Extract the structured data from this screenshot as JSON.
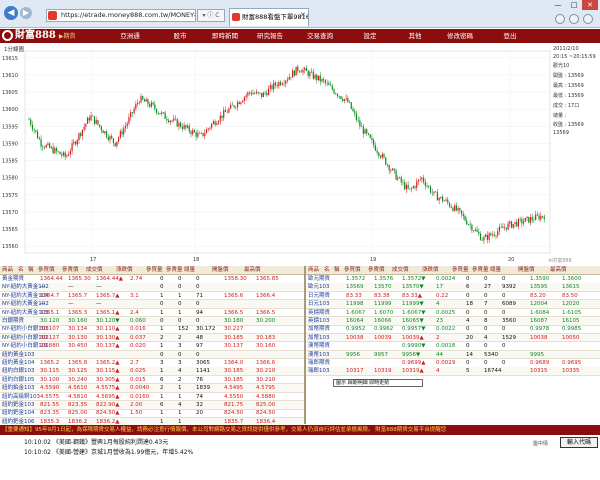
{
  "browser": {
    "address": "https://etrade.money888.com.tw/MONEY888/",
    "tab_title": "財富888看盤下單9816260",
    "tools": "▾ ⓘ C",
    "back": "◀",
    "fwd": "▶",
    "close": "✕",
    "win_min": "—",
    "win_max": "□",
    "win_close": "✕"
  },
  "site": {
    "logo": "財富888",
    "logo_sub": "▶期貨",
    "nav": [
      "亞洲通",
      "股市",
      "即時新聞",
      "研究報告",
      "交易查詢",
      "設定",
      "其他",
      "修改密碼",
      "登出"
    ]
  },
  "chart_panel": {
    "title": "1分線圖",
    "y_ticks": [
      "13615",
      "13610",
      "13605",
      "13600",
      "13595",
      "13590",
      "13585",
      "13580",
      "13575",
      "13570",
      "13565",
      "13560"
    ],
    "x_ticks": [
      "17",
      "18",
      "19",
      "20"
    ],
    "side": {
      "date": "2011/2/10",
      "time": "20:15 ~20:15:59",
      "label_title": "歡光10",
      "open": "開盤 : 13569",
      "high": "最高 : 13569",
      "low": "最低 : 13569",
      "vol": "成交 : 17口",
      "amt": "總量 :",
      "close": "收盤 : 13569",
      "chg": "13569"
    },
    "watermark": "※財富888"
  },
  "chart_data": {
    "type": "candlestick",
    "title": "1分線圖",
    "y_range": [
      13558,
      13617
    ],
    "x_ticks": [
      "17",
      "18",
      "19",
      "20"
    ],
    "close_path_estimate": [
      13597,
      13590,
      13588,
      13586,
      13592,
      13598,
      13594,
      13590,
      13596,
      13603,
      13601,
      13598,
      13596,
      13594,
      13592,
      13596,
      13599,
      13602,
      13605,
      13604,
      13607,
      13609,
      13612,
      13610,
      13608,
      13605,
      13602,
      13595,
      13590,
      13585,
      13580,
      13576,
      13580,
      13575,
      13573,
      13570,
      13566,
      13562,
      13564,
      13566,
      13567,
      13568,
      13569
    ]
  },
  "table_left": {
    "headers": [
      "商品",
      "名",
      "稱",
      "參買價",
      "參賣價",
      "成交價",
      "漲跌價",
      "參買量",
      "參賣量",
      "總量",
      "開盤價",
      "最高價"
    ],
    "rows": [
      {
        "name": "黃金期貨",
        "bid": "1364.44",
        "ask": "1365.30",
        "last": "1364.44▲",
        "chg": "2.74",
        "bq": "0",
        "aq": "0",
        "vol": "0",
        "open": "1358.30",
        "high": "1365.85",
        "c": "r"
      },
      {
        "name": "NY-紐約大黃金102",
        "bid": "—",
        "ask": "—",
        "last": "—",
        "chg": "",
        "bq": "0",
        "aq": "0",
        "vol": "0",
        "open": "",
        "high": "",
        "c": "k"
      },
      {
        "name": "NY-紐約大黃金104",
        "bid": "1364.7",
        "ask": "1365.7",
        "last": "1365.7▲",
        "chg": "3.1",
        "bq": "1",
        "aq": "1",
        "vol": "71",
        "open": "1365.6",
        "high": "1366.4",
        "c": "r"
      },
      {
        "name": "NY-紐約大黃金102",
        "bid": "—",
        "ask": "—",
        "last": "—",
        "chg": "",
        "bq": "0",
        "aq": "0",
        "vol": "0",
        "open": "",
        "high": "",
        "c": "k"
      },
      {
        "name": "NY-紐約大黃金103",
        "bid": "1365.1",
        "ask": "1365.3",
        "last": "1365.1▲",
        "chg": "2.4",
        "bq": "1",
        "aq": "1",
        "vol": "94",
        "open": "1366.5",
        "high": "1366.5",
        "c": "r"
      },
      {
        "name": "白銀期貨",
        "bid": "30.120",
        "ask": "30.160",
        "last": "30.120▼",
        "chg": "0.060",
        "bq": "0",
        "aq": "0",
        "vol": "0",
        "open": "30.180",
        "high": "30.200",
        "c": "g"
      },
      {
        "name": "NY-紐約小白銀103",
        "bid": "30.107",
        "ask": "30.134",
        "last": "30.110▲",
        "chg": "0.016",
        "bq": "1",
        "aq": "152",
        "vol": "30.172",
        "open": "30.227",
        "high": "",
        "c": "r"
      },
      {
        "name": "NY-紐約小白銀102",
        "bid": "30.127",
        "ask": "30.130",
        "last": "30.130▲",
        "chg": "0.037",
        "bq": "2",
        "aq": "2",
        "vol": "48",
        "open": "30.185",
        "high": "30.183",
        "c": "r"
      },
      {
        "name": "NY-紐約小白銀105",
        "bid": "29.880",
        "ask": "30.450",
        "last": "30.137▲",
        "chg": "0.020",
        "bq": "1",
        "aq": "3",
        "vol": "97",
        "open": "30.137",
        "high": "30.160",
        "c": "r"
      },
      {
        "name": "紐約黃金103",
        "bid": "",
        "ask": "",
        "last": "",
        "chg": "",
        "bq": "0",
        "aq": "0",
        "vol": "0",
        "open": "",
        "high": "",
        "c": "k"
      },
      {
        "name": "紐約黃金104",
        "bid": "1365.2",
        "ask": "1365.8",
        "last": "1365.2▲",
        "chg": "2.7",
        "bq": "3",
        "aq": "3",
        "vol": "3065",
        "open": "1364.0",
        "high": "1366.6",
        "c": "r"
      },
      {
        "name": "紐約白銀103",
        "bid": "30.115",
        "ask": "30.125",
        "last": "30.115▲",
        "chg": "0.025",
        "bq": "1",
        "aq": "4",
        "vol": "1141",
        "open": "30.185",
        "high": "30.210",
        "c": "r"
      },
      {
        "name": "紐約白銀105",
        "bid": "30.100",
        "ask": "30.240",
        "last": "30.305▲",
        "chg": "0.015",
        "bq": "6",
        "aq": "2",
        "vol": "76",
        "open": "30.185",
        "high": "30.210",
        "c": "r"
      },
      {
        "name": "紐約鉑金103",
        "bid": "4.5590",
        "ask": "4.5610",
        "last": "4.5575▲",
        "chg": "0.0040",
        "bq": "2",
        "aq": "1",
        "vol": "1839",
        "open": "4.5495",
        "high": "4.5795",
        "c": "r"
      },
      {
        "name": "紐約高級銅103",
        "bid": "4.5575",
        "ask": "4.5810",
        "last": "4.5695▲",
        "chg": "0.0160",
        "bq": "1",
        "aq": "1",
        "vol": "74",
        "open": "4.5550",
        "high": "4.5880",
        "c": "r"
      },
      {
        "name": "紐約鈀金103",
        "bid": "821.55",
        "ask": "823.35",
        "last": "822.90▲",
        "chg": "2.00",
        "bq": "6",
        "aq": "4",
        "vol": "32",
        "open": "821.75",
        "high": "825.00",
        "c": "r"
      },
      {
        "name": "紐約鈀金104",
        "bid": "823.35",
        "ask": "825.00",
        "last": "824.50▲",
        "chg": "1.50",
        "bq": "1",
        "aq": "1",
        "vol": "20",
        "open": "824.50",
        "high": "824.50",
        "c": "r"
      },
      {
        "name": "紐約鈀金106",
        "bid": "1835.3",
        "ask": "1836.2",
        "last": "1836.2▲",
        "chg": "",
        "bq": "1",
        "aq": "1",
        "vol": "",
        "open": "1835.7",
        "high": "1836.4",
        "c": "r"
      }
    ]
  },
  "table_right": {
    "headers": [
      "商品",
      "名",
      "稱",
      "參買價",
      "參賣價",
      "成交價",
      "漲跌價",
      "參買量",
      "參賣量",
      "總量",
      "開盤價",
      "最高價"
    ],
    "rows": [
      {
        "name": "歐元期貨",
        "bid": "1.3572",
        "ask": "1.3576",
        "last": "1.3572▼",
        "chg": "0.0024",
        "bq": "0",
        "aq": "0",
        "vol": "0",
        "open": "1.3590",
        "high": "1.3600",
        "c": "g"
      },
      {
        "name": "歐元103",
        "bid": "13569",
        "ask": "13570",
        "last": "13570▼",
        "chg": "17",
        "bq": "6",
        "aq": "27",
        "vol": "9392",
        "open": "13595",
        "high": "13615",
        "c": "g"
      },
      {
        "name": "日元期貨",
        "bid": "83.33",
        "ask": "83.38",
        "last": "83.33▲",
        "chg": "0.22",
        "bq": "0",
        "aq": "0",
        "vol": "0",
        "open": "83.20",
        "high": "83.50",
        "c": "r"
      },
      {
        "name": "日元103",
        "bid": "11998",
        "ask": "11999",
        "last": "11999▼",
        "chg": "4",
        "bq": "18",
        "aq": "7",
        "vol": "6089",
        "open": "12004",
        "high": "12020",
        "c": "g"
      },
      {
        "name": "英鎊期貨",
        "bid": "1.6067",
        "ask": "1.6070",
        "last": "1.6067▼",
        "chg": "0.0025",
        "bq": "0",
        "aq": "0",
        "vol": "0",
        "open": "1.6084",
        "high": "1.6105",
        "c": "g"
      },
      {
        "name": "英鎊103",
        "bid": "16064",
        "ask": "16066",
        "last": "16065▼",
        "chg": "23",
        "bq": "4",
        "aq": "8",
        "vol": "3560",
        "open": "16087",
        "high": "16105",
        "c": "g"
      },
      {
        "name": "加幣期貨",
        "bid": "0.9952",
        "ask": "0.9962",
        "last": "0.9957▼",
        "chg": "0.0022",
        "bq": "0",
        "aq": "0",
        "vol": "0",
        "open": "0.9978",
        "high": "0.9985",
        "c": "g"
      },
      {
        "name": "加幣103",
        "bid": "10038",
        "ask": "10039",
        "last": "10039▲",
        "chg": "2",
        "bq": "20",
        "aq": "4",
        "vol": "1529",
        "open": "10038",
        "high": "10050",
        "c": "r"
      },
      {
        "name": "澳幣期貨",
        "bid": "",
        "ask": "",
        "last": "0.9990▼",
        "chg": "0.0018",
        "bq": "0",
        "aq": "0",
        "vol": "0",
        "open": "",
        "high": "",
        "c": "g"
      },
      {
        "name": "澳幣103",
        "bid": "9956",
        "ask": "9957",
        "last": "9956▼",
        "chg": "44",
        "bq": "14",
        "aq": "5340",
        "vol": "",
        "open": "9995",
        "high": "",
        "c": "g"
      },
      {
        "name": "瑞郎期貨",
        "bid": "",
        "ask": "",
        "last": "0.9699▲",
        "chg": "0.0029",
        "bq": "0",
        "aq": "0",
        "vol": "0",
        "open": "0.9689",
        "high": "0.9695",
        "c": "r"
      },
      {
        "name": "瑞郎103",
        "bid": "10317",
        "ask": "10319",
        "last": "10319▲",
        "chg": "4",
        "bq": "5",
        "aq": "16744",
        "vol": "",
        "open": "10315",
        "high": "10335",
        "c": "r"
      }
    ],
    "popup": "圖示 歸期明細 即時走勢"
  },
  "ticker": "【重要通知】95年9月1日起，為保障期貨交易人權益，請務必注意行情報價。本公司對網路交易之資訊提供僅供參考，交易人仍須自行評估並承擔風險。 財富888期貨交易平台提醒您",
  "news": {
    "lines": [
      "10:10:02 《美國-鋼鐵》豐興1月每股純利潤達0.43元",
      "10:10:02 《美國-營建》京城1月營收為1.99億元，年增5.42%"
    ],
    "label": "盤中情",
    "code_button": "輸入代碼"
  }
}
